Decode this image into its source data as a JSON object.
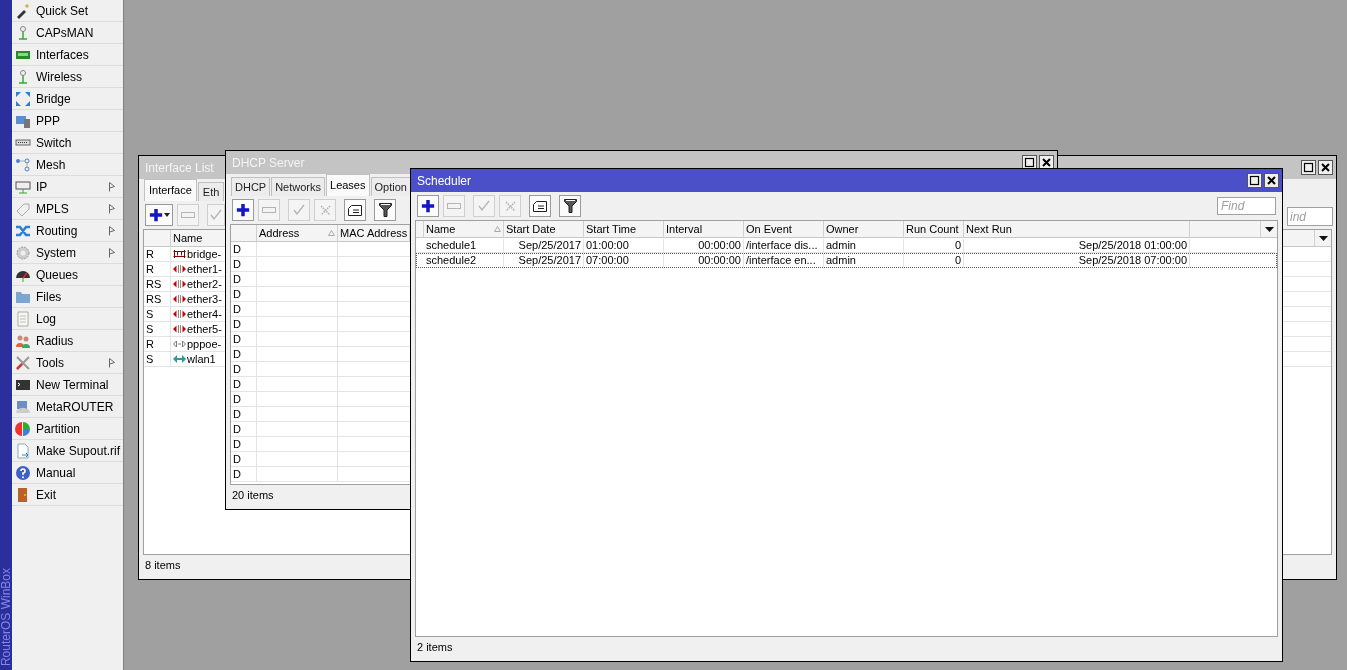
{
  "sidebar": {
    "brand": "RouterOS WinBox",
    "items": [
      {
        "label": "Quick Set",
        "submenu": false
      },
      {
        "label": "CAPsMAN",
        "submenu": false
      },
      {
        "label": "Interfaces",
        "submenu": false
      },
      {
        "label": "Wireless",
        "submenu": false
      },
      {
        "label": "Bridge",
        "submenu": false
      },
      {
        "label": "PPP",
        "submenu": false
      },
      {
        "label": "Switch",
        "submenu": false
      },
      {
        "label": "Mesh",
        "submenu": false
      },
      {
        "label": "IP",
        "submenu": true
      },
      {
        "label": "MPLS",
        "submenu": true
      },
      {
        "label": "Routing",
        "submenu": true
      },
      {
        "label": "System",
        "submenu": true
      },
      {
        "label": "Queues",
        "submenu": false
      },
      {
        "label": "Files",
        "submenu": false
      },
      {
        "label": "Log",
        "submenu": false
      },
      {
        "label": "Radius",
        "submenu": false
      },
      {
        "label": "Tools",
        "submenu": true
      },
      {
        "label": "New Terminal",
        "submenu": false
      },
      {
        "label": "MetaROUTER",
        "submenu": false
      },
      {
        "label": "Partition",
        "submenu": false
      },
      {
        "label": "Make Supout.rif",
        "submenu": false
      },
      {
        "label": "Manual",
        "submenu": false
      },
      {
        "label": "Exit",
        "submenu": false
      }
    ]
  },
  "interface_list": {
    "title": "Interface List",
    "active": false,
    "tabs": [
      {
        "label": "Interface",
        "selected": true
      },
      {
        "label": "Eth",
        "selected": false
      }
    ],
    "toolbar": [
      {
        "kind": "add_menu",
        "disabled": false
      },
      {
        "kind": "remove",
        "disabled": true
      },
      {
        "kind": "enable",
        "disabled": true
      }
    ],
    "find": {
      "placeholder": "ind"
    },
    "columns": [
      {
        "label": "Name",
        "sorted": false
      }
    ],
    "rows": [
      {
        "flags": "R",
        "kind": "bridge",
        "name": "bridge-"
      },
      {
        "flags": "R",
        "kind": "ether",
        "name": "ether1-"
      },
      {
        "flags": "RS",
        "kind": "ether",
        "name": "ether2-"
      },
      {
        "flags": "RS",
        "kind": "ether",
        "name": "ether3-"
      },
      {
        "flags": "S",
        "kind": "ether",
        "name": "ether4-"
      },
      {
        "flags": "S",
        "kind": "ether",
        "name": "ether5-"
      },
      {
        "flags": "R",
        "kind": "pppoe",
        "name": "pppoe-"
      },
      {
        "flags": "S",
        "kind": "wireless",
        "name": "wlan1"
      }
    ],
    "status": "8 items"
  },
  "dhcp_server": {
    "title": "DHCP Server",
    "active": false,
    "tabs": [
      {
        "label": "DHCP",
        "selected": false
      },
      {
        "label": "Networks",
        "selected": false
      },
      {
        "label": "Leases",
        "selected": true
      },
      {
        "label": "Option",
        "selected": false
      }
    ],
    "toolbar": [
      {
        "kind": "add",
        "disabled": false
      },
      {
        "kind": "remove",
        "disabled": true
      },
      {
        "kind": "enable",
        "disabled": true
      },
      {
        "kind": "disable",
        "disabled": true
      },
      {
        "kind": "comment",
        "disabled": false
      },
      {
        "kind": "filter",
        "disabled": false
      }
    ],
    "columns": [
      {
        "label": "Address",
        "sorted": true
      },
      {
        "label": "MAC Address",
        "sorted": false
      }
    ],
    "rows": [
      {
        "flags": "D"
      },
      {
        "flags": "D"
      },
      {
        "flags": "D"
      },
      {
        "flags": "D"
      },
      {
        "flags": "D"
      },
      {
        "flags": "D"
      },
      {
        "flags": "D"
      },
      {
        "flags": "D"
      },
      {
        "flags": "D"
      },
      {
        "flags": "D"
      },
      {
        "flags": "D"
      },
      {
        "flags": "D"
      },
      {
        "flags": "D"
      },
      {
        "flags": "D"
      },
      {
        "flags": "D"
      },
      {
        "flags": "D"
      }
    ],
    "status": "20 items"
  },
  "scheduler": {
    "title": "Scheduler",
    "active": true,
    "toolbar": [
      {
        "kind": "add",
        "disabled": false
      },
      {
        "kind": "remove",
        "disabled": true
      },
      {
        "kind": "enable",
        "disabled": true
      },
      {
        "kind": "disable",
        "disabled": true
      },
      {
        "kind": "comment",
        "disabled": false
      },
      {
        "kind": "filter",
        "disabled": false
      }
    ],
    "find": {
      "placeholder": "Find"
    },
    "columns": [
      {
        "label": "Name",
        "sorted": true
      },
      {
        "label": "Start Date",
        "sorted": false
      },
      {
        "label": "Start Time",
        "sorted": false
      },
      {
        "label": "Interval",
        "sorted": false
      },
      {
        "label": "On Event",
        "sorted": false
      },
      {
        "label": "Owner",
        "sorted": false
      },
      {
        "label": "Run Count",
        "sorted": false
      },
      {
        "label": "Next Run",
        "sorted": false
      }
    ],
    "rows": [
      {
        "cells": [
          "schedule1",
          "Sep/25/2017",
          "01:00:00",
          "00:00:00",
          "/interface dis...",
          "admin",
          "0",
          "Sep/25/2018 01:00:00"
        ],
        "focused": false
      },
      {
        "cells": [
          "schedule2",
          "Sep/25/2017",
          "07:00:00",
          "00:00:00",
          "/interface en...",
          "admin",
          "0",
          "Sep/25/2018 07:00:00"
        ],
        "focused": true
      }
    ],
    "status": "2 items"
  }
}
